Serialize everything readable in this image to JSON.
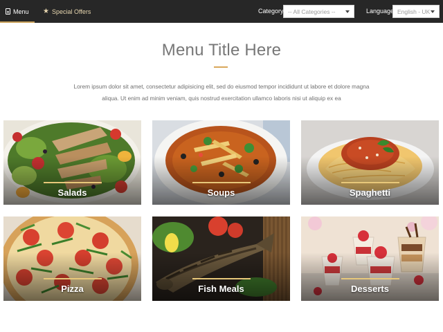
{
  "nav": {
    "menu_label": "Menu",
    "offers_label": "Special Offers",
    "category_label": "Category",
    "category_value": "-- All Categories --",
    "language_label": "Language",
    "language_value": "English - UK"
  },
  "header": {
    "title": "Menu Title Here",
    "intro": "Lorem ipsum dolor sit amet, consectetur adipisicing elit, sed do eiusmod tempor incididunt ut labore et dolore magna aliqua. Ut enim ad minim veniam, quis nostrud exercitation ullamco laboris nisi ut aliquip ex ea"
  },
  "categories": [
    {
      "name": "Salads"
    },
    {
      "name": "Soups"
    },
    {
      "name": "Spaghetti"
    },
    {
      "name": "Pizza"
    },
    {
      "name": "Fish Meals"
    },
    {
      "name": "Desserts"
    }
  ],
  "colors": {
    "topbar": "#272727",
    "accent": "#c8a15a",
    "title_rule": "#d9a75a"
  }
}
